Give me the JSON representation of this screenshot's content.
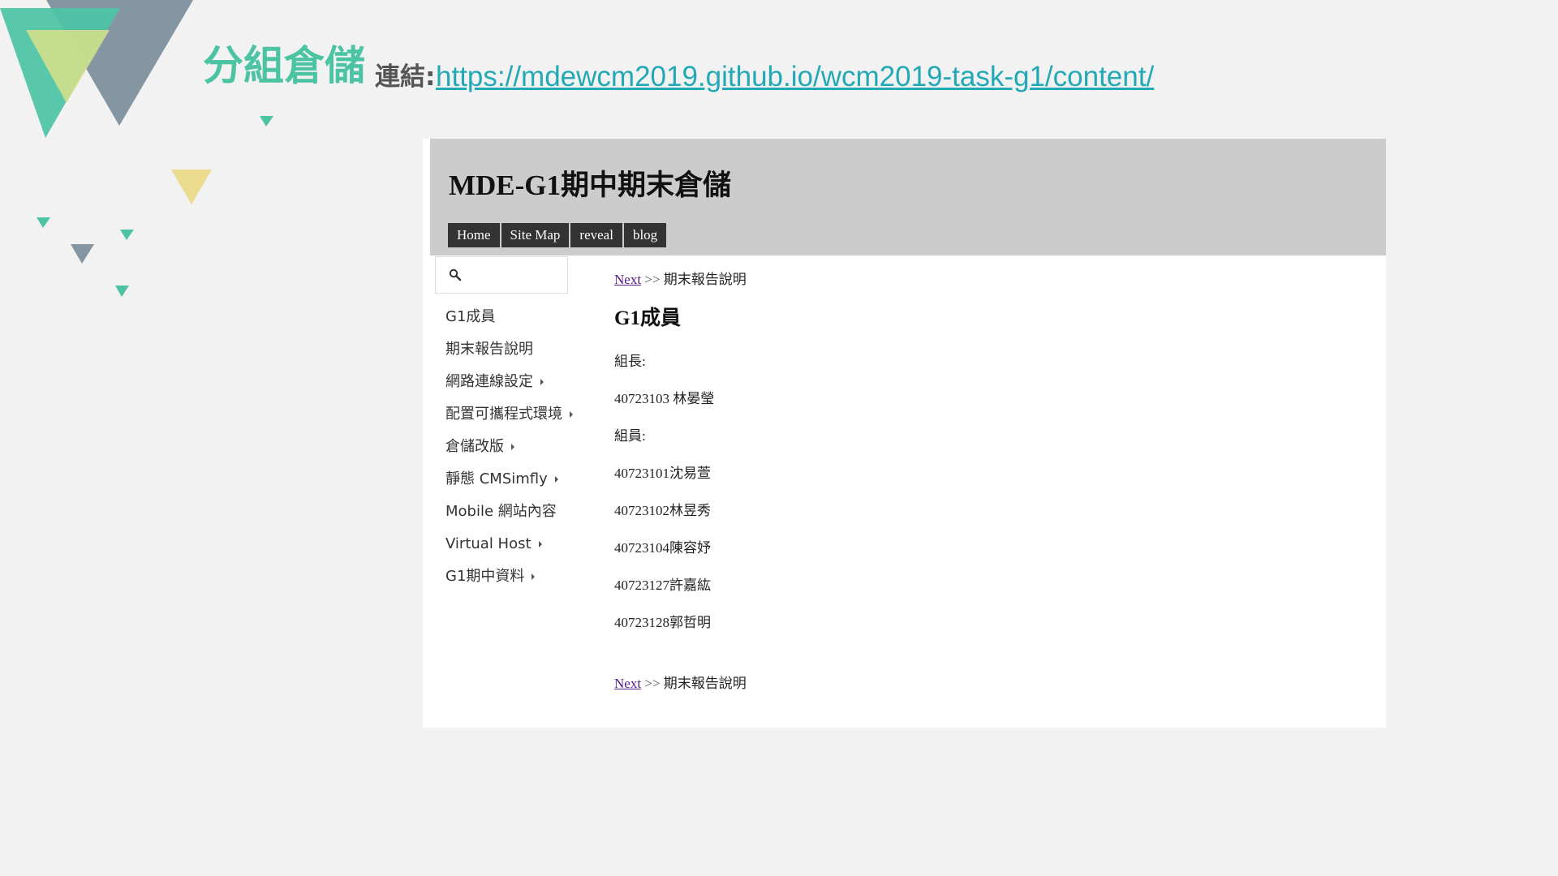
{
  "slide": {
    "title": "分組倉儲",
    "link_label": "連結:",
    "link_url": "https://mdewcm2019.github.io/wcm2019-task-g1/content/"
  },
  "site": {
    "title": "MDE-G1期中期末倉儲",
    "nav": [
      "Home",
      "Site Map",
      "reveal",
      "blog"
    ],
    "search": {
      "placeholder": "",
      "value": ""
    },
    "sidebar": [
      {
        "label": "G1成員",
        "has_submenu": false
      },
      {
        "label": "期末報告說明",
        "has_submenu": false
      },
      {
        "label": "網路連線設定",
        "has_submenu": true
      },
      {
        "label": "配置可攜程式環境",
        "has_submenu": true
      },
      {
        "label": "倉儲改版",
        "has_submenu": true
      },
      {
        "label": "靜態 CMSimfly",
        "has_submenu": true
      },
      {
        "label": "Mobile 網站內容",
        "has_submenu": false
      },
      {
        "label": "Virtual Host",
        "has_submenu": true
      },
      {
        "label": "G1期中資料",
        "has_submenu": true
      }
    ],
    "content": {
      "nav_top": {
        "link": "Next",
        "sep": ">>",
        "target": "期末報告說明"
      },
      "heading": "G1成員",
      "leader_label": "組長:",
      "leader": "40723103 林晏瑩",
      "members_label": "組員:",
      "members": [
        "40723101沈易萱",
        "40723102林昱秀",
        "40723104陳容妤",
        "40723127許嘉紘",
        "40723128郭哲明"
      ],
      "nav_bottom": {
        "link": "Next",
        "sep": ">>",
        "target": "期末報告說明"
      }
    }
  },
  "colors": {
    "background": "#f2f2f2",
    "title_teal": "#4cc4a4",
    "link_cyan": "#22a9b5",
    "header_gray": "#cccccc",
    "nav_dark": "#333333",
    "visited_link": "#551a8b",
    "deco_yellow": "#eadb8e",
    "deco_slate": "#8596a3"
  }
}
